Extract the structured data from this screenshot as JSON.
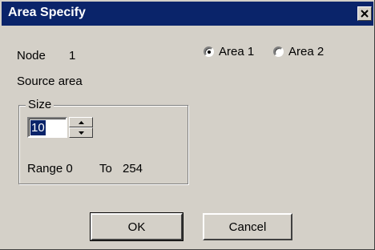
{
  "window": {
    "title": "Area Specify",
    "close_icon": "close-icon"
  },
  "node": {
    "label": "Node",
    "value": "1"
  },
  "area_radio": {
    "options": [
      {
        "label": "Area 1",
        "selected": true
      },
      {
        "label": "Area 2",
        "selected": false
      }
    ]
  },
  "source_area": {
    "label": "Source area"
  },
  "size_group": {
    "legend": "Size",
    "value": "10",
    "range_label": "Range 0",
    "to_label": "To",
    "to_value": "254"
  },
  "buttons": {
    "ok": "OK",
    "cancel": "Cancel"
  },
  "colors": {
    "titlebar": "#0a246a",
    "face": "#d4d0c8"
  }
}
